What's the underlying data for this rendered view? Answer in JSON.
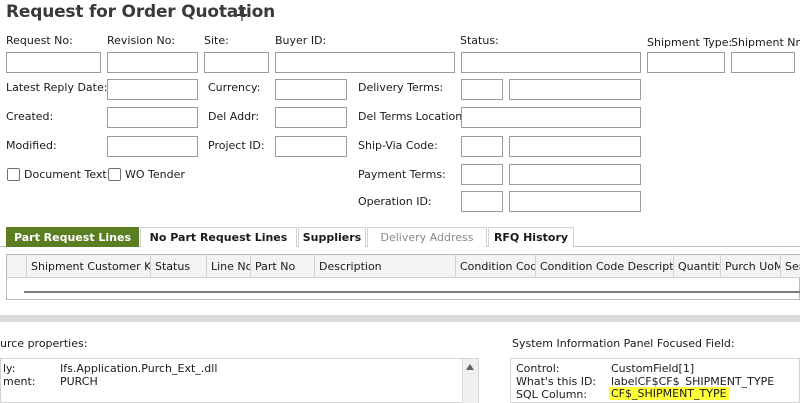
{
  "page": {
    "title": "Request for Order Quotation"
  },
  "header_fields": {
    "request_no": {
      "label": "Request No:",
      "value": ""
    },
    "revision_no": {
      "label": "Revision No:",
      "value": ""
    },
    "site": {
      "label": "Site:",
      "value": ""
    },
    "buyer_id": {
      "label": "Buyer ID:",
      "value": ""
    },
    "status": {
      "label": "Status:",
      "value": ""
    },
    "shipment_type": {
      "label": "Shipment Type:",
      "value": ""
    },
    "shipment_nr": {
      "label": "Shipment Nr.:",
      "value": ""
    },
    "latest_reply_date": {
      "label": "Latest Reply Date:",
      "value": ""
    },
    "currency": {
      "label": "Currency:",
      "value": ""
    },
    "delivery_terms": {
      "label": "Delivery Terms:",
      "value": "",
      "desc": ""
    },
    "created": {
      "label": "Created:",
      "value": ""
    },
    "del_addr": {
      "label": "Del Addr:",
      "value": ""
    },
    "del_terms_location": {
      "label": "Del Terms Location:",
      "value": ""
    },
    "modified": {
      "label": "Modified:",
      "value": ""
    },
    "project_id": {
      "label": "Project ID:",
      "value": ""
    },
    "ship_via_code": {
      "label": "Ship-Via Code:",
      "value": "",
      "desc": ""
    },
    "document_text": {
      "label": "Document Text",
      "checked": false
    },
    "wo_tender": {
      "label": "WO Tender",
      "checked": false
    },
    "payment_terms": {
      "label": "Payment Terms:",
      "value": "",
      "desc": ""
    },
    "operation_id": {
      "label": "Operation ID:",
      "value": "",
      "desc": ""
    }
  },
  "tabs": [
    {
      "label": "Part Request Lines",
      "active": true
    },
    {
      "label": "No Part Request Lines",
      "active": false
    },
    {
      "label": "Suppliers",
      "active": false
    },
    {
      "label": "Delivery Address",
      "active": false,
      "disabled": true
    },
    {
      "label": "RFQ History",
      "active": false
    }
  ],
  "grid": {
    "columns": [
      "Shipment Customer Key",
      "Status",
      "Line No",
      "Part No",
      "Description",
      "Condition Code",
      "Condition Code Description",
      "Quantity",
      "Purch UoM",
      "Ser"
    ],
    "rows": []
  },
  "source_properties": {
    "title": "urce properties:",
    "rows": [
      {
        "key": "ly:",
        "value": "Ifs.Application.Purch_Ext_.dll"
      },
      {
        "key": "ment:",
        "value": "PURCH"
      }
    ]
  },
  "system_info": {
    "title": "System Information Panel Focused Field:",
    "rows": [
      {
        "key": "Control:",
        "value": "CustomField[1]"
      },
      {
        "key": "What's this ID:",
        "value": "labelCF$CF$_SHIPMENT_TYPE"
      },
      {
        "key": "SQL Column:",
        "value": "CF$_SHIPMENT_TYPE"
      }
    ]
  },
  "colors": {
    "active_tab": "#5b7e22",
    "highlight": "#ffff3a"
  }
}
